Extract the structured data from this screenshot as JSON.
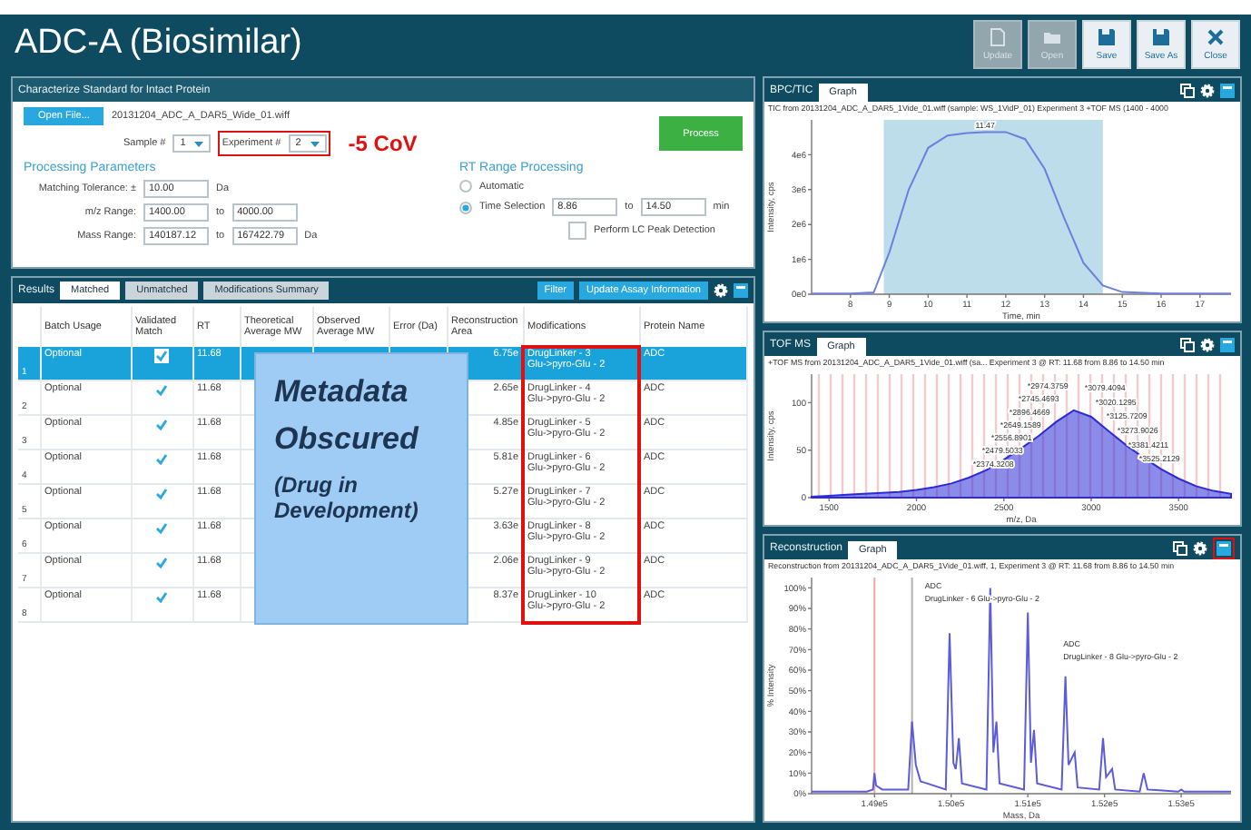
{
  "window": {
    "title": "ADC-A (Biosimilar)"
  },
  "toolbar": [
    {
      "label": "Update",
      "disabled": true
    },
    {
      "label": "Open",
      "disabled": true
    },
    {
      "label": "Save",
      "disabled": false
    },
    {
      "label": "Save As",
      "disabled": false
    },
    {
      "label": "Close",
      "disabled": false
    }
  ],
  "setup_panel": {
    "title": "Characterize Standard for Intact Protein",
    "open_button": "Open File...",
    "file_name": "20131204_ADC_A_DAR5_Wide_01.wiff",
    "sample": {
      "label": "Sample #",
      "value": "1"
    },
    "experiment": {
      "label": "Experiment #",
      "value": "2",
      "highlighted": true
    },
    "callout": "-5 CoV",
    "process_button": "Process",
    "parameters_heading": "Processing Parameters",
    "parameters": [
      {
        "label": "Matching Tolerance: ±",
        "from": "10.00",
        "unit": "Da"
      },
      {
        "label": "m/z Range:",
        "from": "1400.00",
        "to_label": "to",
        "to": "4000.00"
      },
      {
        "label": "Mass Range:",
        "from": "140187.12",
        "to_label": "to",
        "to": "167422.79",
        "unit": "Da"
      }
    ],
    "rt_heading": "RT Range Processing",
    "rt_options": [
      {
        "label": "Automatic",
        "selected": false
      },
      {
        "label": "Time Selection",
        "selected": true,
        "from": "8.86",
        "to_label": "to",
        "to": "14.50",
        "unit": "min"
      }
    ],
    "peak_detection": {
      "label": "Perform LC Peak Detection",
      "checked": false
    }
  },
  "results_panel": {
    "title": "Results",
    "tabs": [
      {
        "label": "Matched",
        "selected": true
      },
      {
        "label": "Unmatched",
        "selected": false
      },
      {
        "label": "Modifications Summary",
        "selected": false
      }
    ],
    "buttons": [
      "Filter",
      "Update Assay Information"
    ],
    "columns": [
      "Batch Usage",
      "Validated Match",
      "RT",
      "Theoretical Average MW",
      "Observed Average MW",
      "Error (Da)",
      "Reconstruction Area",
      "Modifications",
      "Protein Name"
    ],
    "rows": [
      {
        "number": "1",
        "selected": true,
        "batch_usage": "Optional",
        "validated": true,
        "rt": "11.68",
        "reconstruction_area": "6.75e",
        "modifications": "DrugLinker - 3\nGlu->pyro-Glu - 2",
        "protein_name": "ADC"
      },
      {
        "number": "2",
        "selected": false,
        "batch_usage": "Optional",
        "validated": true,
        "rt": "11.68",
        "reconstruction_area": "2.65e",
        "modifications": "DrugLinker - 4\nGlu->pyro-Glu - 2",
        "protein_name": "ADC"
      },
      {
        "number": "3",
        "selected": false,
        "batch_usage": "Optional",
        "validated": true,
        "rt": "11.68",
        "reconstruction_area": "4.85e",
        "modifications": "DrugLinker - 5\nGlu->pyro-Glu - 2",
        "protein_name": "ADC"
      },
      {
        "number": "4",
        "selected": false,
        "batch_usage": "Optional",
        "validated": true,
        "rt": "11.68",
        "reconstruction_area": "5.81e",
        "modifications": "DrugLinker - 6\nGlu->pyro-Glu - 2",
        "protein_name": "ADC"
      },
      {
        "number": "5",
        "selected": false,
        "batch_usage": "Optional",
        "validated": true,
        "rt": "11.68",
        "reconstruction_area": "5.27e",
        "modifications": "DrugLinker - 7\nGlu->pyro-Glu - 2",
        "protein_name": "ADC"
      },
      {
        "number": "6",
        "selected": false,
        "batch_usage": "Optional",
        "validated": true,
        "rt": "11.68",
        "reconstruction_area": "3.63e",
        "modifications": "DrugLinker - 8\nGlu->pyro-Glu - 2",
        "protein_name": "ADC"
      },
      {
        "number": "7",
        "selected": false,
        "batch_usage": "Optional",
        "validated": true,
        "rt": "11.68",
        "reconstruction_area": "2.06e",
        "modifications": "DrugLinker - 9\nGlu->pyro-Glu - 2",
        "protein_name": "ADC"
      },
      {
        "number": "8",
        "selected": false,
        "batch_usage": "Optional",
        "validated": true,
        "rt": "11.68",
        "reconstruction_area": "8.37e",
        "modifications": "DrugLinker - 10\nGlu->pyro-Glu - 2",
        "protein_name": "ADC"
      }
    ],
    "redaction": {
      "title": "Metadata Obscured",
      "note": "(Drug in Development)"
    },
    "modifications_highlighted": true
  },
  "graph_panels": [
    {
      "title": "BPC/TIC",
      "tab": {
        "label": "Graph",
        "selected": true
      },
      "maximize_highlighted": false,
      "caption": "TIC from 20131204_ADC_A_DAR5_1Vide_01.wiff (sample: WS_1VidP_01) Experiment 3 +TOF MS (1400 - 4000",
      "chart_data": {
        "type": "line",
        "xlabel": "Time, min",
        "ylabel": "Intensity, cps",
        "xlim": [
          7,
          17.8
        ],
        "ylim": [
          0,
          5000000
        ],
        "xticks": [
          8,
          9,
          10,
          11,
          12,
          13,
          14,
          15,
          16,
          17
        ],
        "yticks": [
          {
            "value": 0,
            "label": "0e0"
          },
          {
            "value": 1000000,
            "label": "1e6"
          },
          {
            "value": 2000000,
            "label": "2e6"
          },
          {
            "value": 3000000,
            "label": "3e6"
          },
          {
            "value": 4000000,
            "label": "4e6"
          }
        ],
        "x": [
          7,
          8,
          8.6,
          9,
          9.5,
          10,
          10.5,
          11,
          11.47,
          12,
          12.5,
          13,
          13.5,
          14,
          14.5,
          15,
          16,
          17.8
        ],
        "series": [
          {
            "color": "#6b7fe0",
            "values": [
              20000,
              20000,
              50000,
              1200000,
              3000000,
              4200000,
              4550000,
              4620000,
              4650000,
              4650000,
              4450000,
              3600000,
              2200000,
              900000,
              250000,
              60000,
              20000,
              20000
            ]
          }
        ],
        "bands": [
          {
            "axis": "x",
            "from": 8.86,
            "to": 14.5,
            "color": "#bcdde9"
          }
        ],
        "annotations": [
          "11.47"
        ]
      }
    },
    {
      "title": "TOF MS",
      "tab": {
        "label": "Graph",
        "selected": true
      },
      "maximize_highlighted": false,
      "caption": "+TOF MS from 20131204_ADC_A_DAR5_1Vide_01.wiff (sa...  Experiment 3 @ RT: 11.68 from 8.86 to 14.50 min",
      "chart_data": {
        "type": "area",
        "xlabel": "m/z, Da",
        "ylabel": "Intensity, cps",
        "xlim": [
          1400,
          3800
        ],
        "ylim": [
          0,
          130
        ],
        "grid": true,
        "xticks": [
          1500,
          2000,
          2500,
          3000,
          3500
        ],
        "yticks": [
          0,
          50,
          100
        ],
        "x": [
          1400,
          1500,
          1600,
          1700,
          1800,
          1900,
          2000,
          2100,
          2200,
          2300,
          2400,
          2500,
          2600,
          2700,
          2800,
          2900,
          3000,
          3100,
          3200,
          3300,
          3400,
          3500,
          3600,
          3700,
          3800
        ],
        "series": [
          {
            "color": "#2b2bd8",
            "values": [
              1,
              2,
              3,
              4,
              5,
              6,
              8,
              11,
              15,
              21,
              29,
              40,
              52,
              65,
              80,
              92,
              85,
              70,
              55,
              42,
              30,
              20,
              12,
              7,
              4
            ]
          }
        ],
        "annotations": [
          "*2974.3759",
          "*2745.4693",
          "*2896.4669",
          "*2649.1589",
          "*2556.8901",
          "*2479.5033",
          "*2374.3208",
          "*3079.4094",
          "*3020.1295",
          "*3125.7209",
          "*3273.9026",
          "*3381.4211",
          "*3525.2129"
        ]
      }
    },
    {
      "title": "Reconstruction",
      "tab": {
        "label": "Graph",
        "selected": true
      },
      "maximize_highlighted": true,
      "caption": "Reconstruction from 20131204_ADC_A_DAR5_1Vide_01.wiff, 1, Experiment 3 @ RT: 11.68 from 8.86 to 14.50 min",
      "chart_data": {
        "type": "line",
        "xlabel": "Mass, Da",
        "ylabel": "% Intensity",
        "xlim": [
          148180,
          153650
        ],
        "ylim": [
          0,
          105
        ],
        "xticks": [
          {
            "value": 149000,
            "label": "1.49e5"
          },
          {
            "value": 150000,
            "label": "1.50e5"
          },
          {
            "value": 151000,
            "label": "1.51e5"
          },
          {
            "value": 152000,
            "label": "1.52e5"
          },
          {
            "value": 153000,
            "label": "1.53e5"
          }
        ],
        "yticks": [
          {
            "value": 0,
            "label": "0%"
          },
          {
            "value": 10,
            "label": "10%"
          },
          {
            "value": 20,
            "label": "20%"
          },
          {
            "value": 30,
            "label": "30%"
          },
          {
            "value": 40,
            "label": "40%"
          },
          {
            "value": 50,
            "label": "50%"
          },
          {
            "value": 60,
            "label": "60%"
          },
          {
            "value": 70,
            "label": "70%"
          },
          {
            "value": 80,
            "label": "80%"
          },
          {
            "value": 90,
            "label": "90%"
          },
          {
            "value": 100,
            "label": "100%"
          }
        ],
        "x": [
          148180,
          148900,
          148980,
          149000,
          149020,
          149100,
          149440,
          149490,
          149540,
          149600,
          149930,
          149980,
          150030,
          150060,
          150100,
          150140,
          150460,
          150510,
          150550,
          150590,
          150630,
          150950,
          151000,
          151040,
          151080,
          151120,
          151440,
          151490,
          151530,
          151610,
          151650,
          151930,
          151980,
          152020,
          152100,
          152140,
          152460,
          152510,
          152560,
          152960,
          153000,
          153040,
          153650
        ],
        "series": [
          {
            "color": "#5b5bdc",
            "values": [
              1,
              1,
              2,
              10,
              4,
              2,
              2,
              35,
              14,
              6,
              2,
              78,
              15,
              12,
              27,
              5,
              2,
              100,
              20,
              35,
              5,
              2,
              88,
              15,
              31,
              5,
              2,
              57,
              14,
              20,
              3,
              2,
              27,
              8,
              12,
              2,
              1,
              10,
              2,
              1,
              2,
              1,
              1
            ]
          }
        ],
        "ref_lines": [
          {
            "axis": "x",
            "value": 149000,
            "color": "#f2a5a5"
          },
          {
            "axis": "x",
            "value": 149490,
            "color": "#b0b0b0"
          }
        ],
        "annotations": [
          "ADC",
          "DrugLinker - 6 Glu->pyro-Glu - 2",
          "ADC",
          "DrugLinker - 8 Glu->pyro-Glu - 2"
        ]
      }
    }
  ]
}
